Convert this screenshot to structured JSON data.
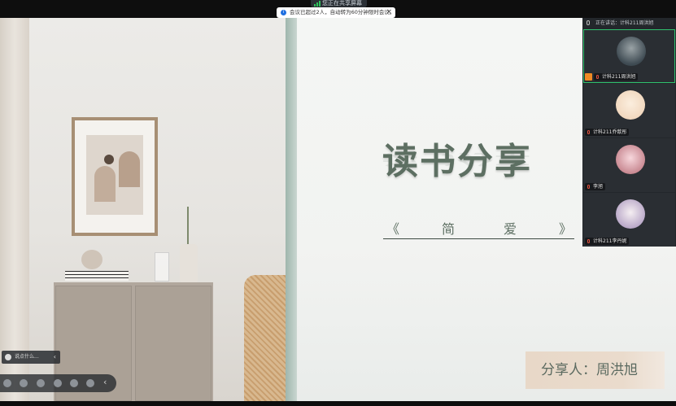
{
  "top_bar": {
    "sharing_status": "您正在共享屏幕"
  },
  "notice": {
    "text": "会议已超过2人，自动转为60分钟限时会议。"
  },
  "slide": {
    "title": "读书分享",
    "subtitle_left": "《",
    "subtitle_char1": "简",
    "subtitle_char2": "爱",
    "subtitle_right": "》",
    "presenter": "分享人：周洪旭"
  },
  "participants": {
    "speaking_label": "正在讲话：计科211周洪旭",
    "items": [
      {
        "name": "计科211周洪旭"
      },
      {
        "name": "计科211乔歆彤"
      },
      {
        "name": "李旭"
      },
      {
        "name": "计科211李丹妮"
      }
    ]
  },
  "mini_bar": {
    "label": "说点什么..."
  },
  "colors": {
    "accent_green": "#30c26e",
    "title_green": "#5d6f62",
    "info_blue": "#1f6fe0"
  }
}
